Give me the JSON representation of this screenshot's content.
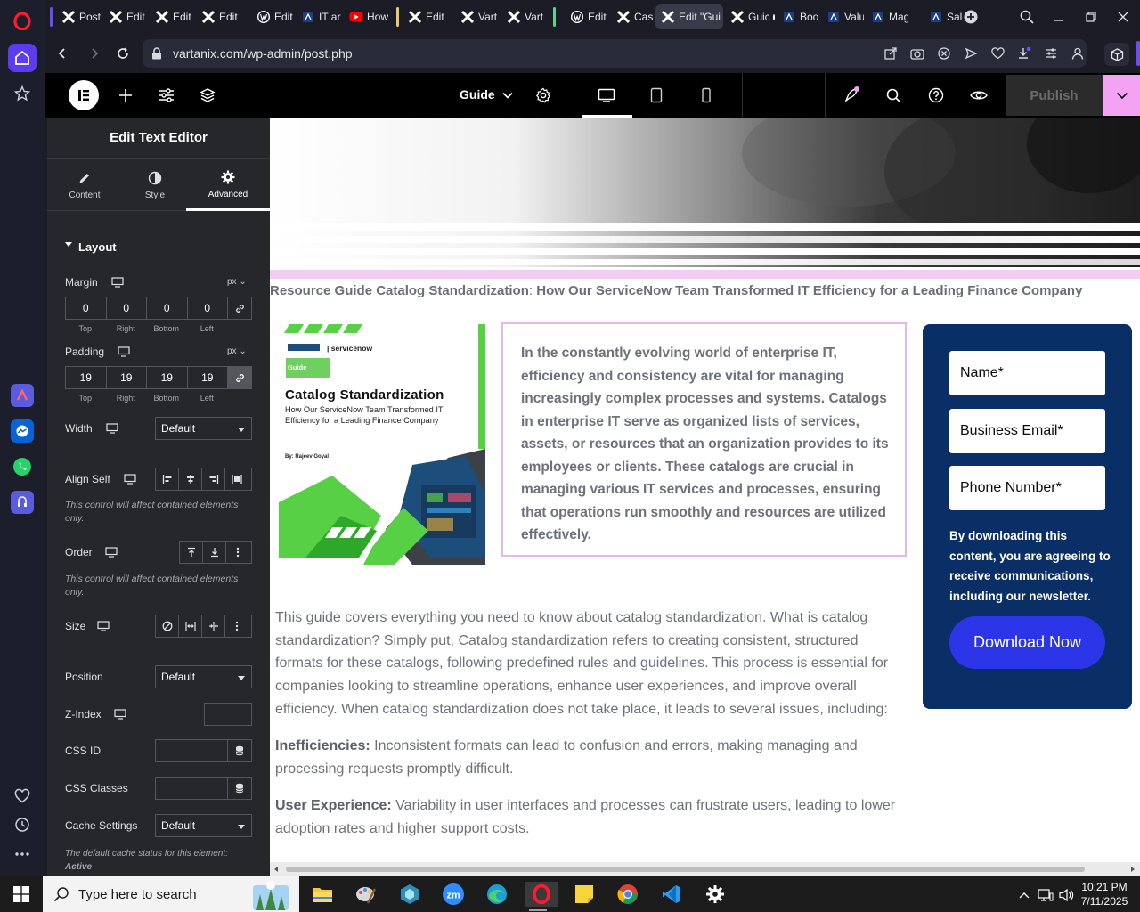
{
  "colors": {
    "elementor_accent": "#f3a2f4",
    "form_card_bg": "#0a2f66",
    "download_button": "#2c36e8",
    "intro_border": "#e4b8ec",
    "cover_green": "#57d046"
  },
  "browser": {
    "tabs": [
      {
        "label": "Post",
        "icon": "elementor-x-icon"
      },
      {
        "label": "Edit",
        "icon": "elementor-x-icon"
      },
      {
        "label": "Edit",
        "icon": "elementor-x-icon"
      },
      {
        "label": "Edit",
        "icon": "elementor-x-icon"
      },
      {
        "label": "Edit",
        "icon": "wordpress-icon"
      },
      {
        "label": "IT ar",
        "icon": "page-icon"
      },
      {
        "label": "How",
        "icon": "youtube-icon"
      },
      {
        "label": "Edit",
        "icon": "elementor-x-icon"
      },
      {
        "label": "Vart",
        "icon": "elementor-x-icon"
      },
      {
        "label": "Vart",
        "icon": "elementor-x-icon"
      },
      {
        "label": "Edit",
        "icon": "wordpress-icon"
      },
      {
        "label": "Case",
        "icon": "elementor-x-icon"
      },
      {
        "label": "Edit \"Gui",
        "icon": "elementor-x-icon"
      },
      {
        "label": "Guic",
        "icon": "elementor-x-icon"
      },
      {
        "label": "Boo",
        "icon": "page-icon"
      },
      {
        "label": "Valu",
        "icon": "page-icon"
      },
      {
        "label": "Mag",
        "icon": "page-icon"
      },
      {
        "label": "Sale",
        "icon": "page-icon"
      }
    ],
    "url": "vartanix.com/wp-admin/post.php"
  },
  "topbar": {
    "page_dropdown": "Guide",
    "publish_label": "Publish"
  },
  "panel": {
    "header": "Edit Text Editor",
    "tabs": {
      "content": "Content",
      "style": "Style",
      "advanced": "Advanced"
    },
    "section_layout": "Layout",
    "margin": {
      "label": "Margin",
      "unit": "px",
      "top": "0",
      "right": "0",
      "bottom": "0",
      "left": "0"
    },
    "padding": {
      "label": "Padding",
      "unit": "px",
      "top": "19",
      "right": "19",
      "bottom": "19",
      "left": "19"
    },
    "dim_labels": {
      "top": "Top",
      "right": "Right",
      "bottom": "Bottom",
      "left": "Left"
    },
    "width": {
      "label": "Width",
      "value": "Default"
    },
    "align_self": {
      "label": "Align Self",
      "note": "This control will affect contained elements only."
    },
    "order": {
      "label": "Order",
      "note": "This control will affect contained elements only."
    },
    "size": {
      "label": "Size"
    },
    "position": {
      "label": "Position",
      "value": "Default"
    },
    "z_index": {
      "label": "Z-Index"
    },
    "css_id": {
      "label": "CSS ID"
    },
    "css_classes": {
      "label": "CSS Classes"
    },
    "cache": {
      "label": "Cache Settings",
      "value": "Default",
      "note_prefix": "The default cache status for this element:",
      "note_status": "Active"
    }
  },
  "canvas": {
    "heading_prefix": "Resource Guide Catalog Standardization",
    "heading_sep": ":",
    "heading_rest": " How Our ServiceNow Team Transformed IT Efficiency for a Leading Finance Company",
    "cover": {
      "brand": "servicenow",
      "badge": "Guide",
      "title": "Catalog Standardization",
      "subtitle": "How Our ServiceNow Team Transformed IT Efficiency for a Leading Finance Company",
      "author": "By: Rajeev Goyal"
    },
    "intro": "In the constantly evolving world of enterprise IT, efficiency and consistency are vital for managing increasingly complex processes and systems. Catalogs in enterprise IT serve as organized lists of services, assets, or resources that an organization provides to its employees or clients. These catalogs are crucial in managing various IT services and processes, ensuring that operations run smoothly and resources are utilized effectively.",
    "form": {
      "name_placeholder": "Name*",
      "email_placeholder": "Business Email*",
      "phone_placeholder": "Phone Number*",
      "consent": "By downloading this content, you are agreeing to receive communications, including our newsletter.",
      "button": "Download Now"
    },
    "body_p1": "This guide covers everything you need to know about catalog standardization. What is catalog standardization? Simply put, Catalog standardization refers to creating consistent, structured formats for these catalogs, following predefined rules and guidelines. This process is essential for companies looking to streamline operations, enhance user experiences, and improve overall efficiency. When catalog standardization does not take place, it leads to several issues, including:",
    "issue1_title": "Inefficiencies:",
    "issue1_text": " Inconsistent formats can lead to confusion and errors, making managing and processing requests promptly difficult.",
    "issue2_title": "User Experience:",
    "issue2_text": " Variability in user interfaces and processes can frustrate users, leading to lower adoption rates and higher support costs."
  },
  "taskbar": {
    "search_placeholder": "Type here to search",
    "time": "10:21 PM",
    "date": "7/11/2025"
  }
}
